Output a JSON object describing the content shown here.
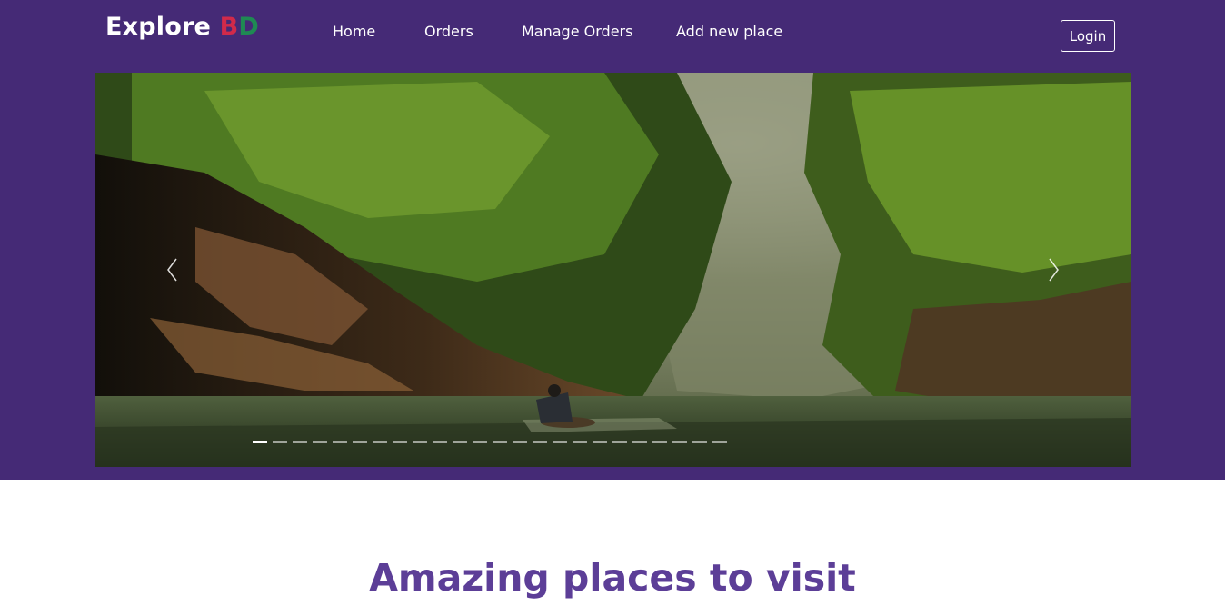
{
  "brand": {
    "explore": "Explore",
    "b": "B",
    "d": "D"
  },
  "nav": {
    "links": [
      {
        "label": "Home"
      },
      {
        "label": "Orders"
      },
      {
        "label": "Manage Orders"
      },
      {
        "label": "Add new place"
      }
    ],
    "login_label": "Login"
  },
  "carousel": {
    "slide_count": 24,
    "active_index": 0,
    "icons": {
      "prev": "chevron-left-icon",
      "next": "chevron-right-icon"
    }
  },
  "section": {
    "title": "Amazing places to visit"
  },
  "colors": {
    "header_bg": "#452a76",
    "brand_b": "#d12a4a",
    "brand_d": "#1f8a53",
    "title": "#5c3e97"
  }
}
